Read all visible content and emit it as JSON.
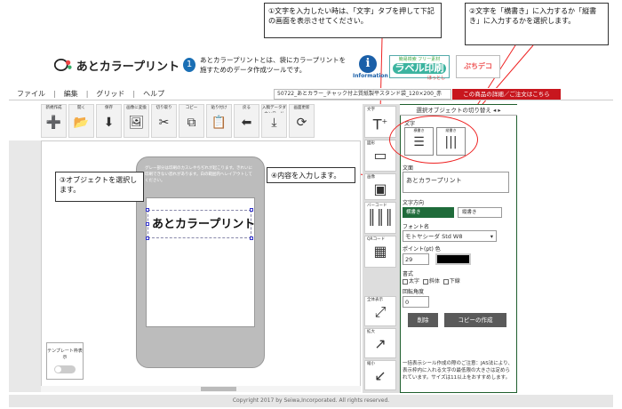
{
  "callouts": {
    "c1": "①文字を入力したい時は、「文字」タブを押して下記の画面を表示させてください。",
    "c2": "②文字を「横書き」に入力するか「縦書き」に入力するかを選択します。",
    "c3": "③オブジェクトを選択します。",
    "c4": "④内容を入力します。"
  },
  "header": {
    "logo_text": "あとカラープリント",
    "logo_num": "1",
    "intro": "あとカラープリントとは、袋にカラープリントを施すためのデータ作成ツールです。",
    "info_label": "Information",
    "banner_top": "簡易検索 フリー素材",
    "banner_main": "ラベル印刷",
    "banner_bottom": "ほっとし",
    "deco_banner": "ぷちデコ"
  },
  "menu": {
    "file": "ファイル",
    "edit": "編集",
    "grid": "グリッド",
    "help": "ヘルプ",
    "file_name": "50722_あとカラー_チャック付上質紙製平スタンド袋_120×200_赤",
    "order_btn": "この商品の詳細／ご注文はこちら"
  },
  "toolbar": [
    {
      "label": "新規作成",
      "icon": "➕"
    },
    {
      "label": "開く",
      "icon": "📂"
    },
    {
      "label": "保存",
      "icon": "⬇"
    },
    {
      "label": "画像に変換",
      "icon": "🖼"
    },
    {
      "label": "切り取り",
      "icon": "✂"
    },
    {
      "label": "コピー",
      "icon": "⧉"
    },
    {
      "label": "貼り付け",
      "icon": "📋"
    },
    {
      "label": "戻る",
      "icon": "⬅"
    },
    {
      "label": "入稿データダウンロード",
      "icon": "⤓"
    },
    {
      "label": "画面更新",
      "icon": "⟳"
    }
  ],
  "canvas": {
    "phone_note": "グレー部分は印刷のカスレやちぢれが起こります。きれいに印刷できない恐れがあります。白の範囲内へレイアウトしてください。",
    "text_object": "あとカラープリント",
    "template_label": "テンプレート枠表示"
  },
  "toolcol": {
    "text": "文字",
    "shape": "図形",
    "image": "画像",
    "barcode": "バーコード",
    "qrcode": "QRコード",
    "fullscreen": "全体表示",
    "zoom_in": "拡大",
    "zoom_out": "縮小"
  },
  "panel": {
    "title": "選択オブジェクトの切り替え",
    "direction_head": "文字",
    "opt_yoko": "横書き",
    "opt_tate": "縦書き",
    "text_label": "文面",
    "text_value": "あとカラープリント",
    "dir_label": "文字方向",
    "dir_yoko": "横書き",
    "dir_tate": "縦書き",
    "font_label": "フォント名",
    "font_value": "モトヤシーダ Std W8",
    "size_label": "ポイント(pt) 色",
    "size_value": "29",
    "style_label": "書式",
    "bold": "太字",
    "italic": "斜体",
    "underline": "下線",
    "rot_label": "回転角度",
    "rot_value": "0",
    "delete_btn": "削除",
    "copy_btn": "コピーの作成",
    "notice": "一括表示シール作成の際のご注意：JAS法により、表示枠内に入れる文字の最低限の大きさは定められています。サイズは11以上をおすすめします。"
  },
  "footer": "Copyright 2017 by Seiwa,Incorporated. All rights reserved.",
  "colors": {
    "accent": "#1f5f2e",
    "order": "#c8161e",
    "callout_line": "#e22"
  }
}
